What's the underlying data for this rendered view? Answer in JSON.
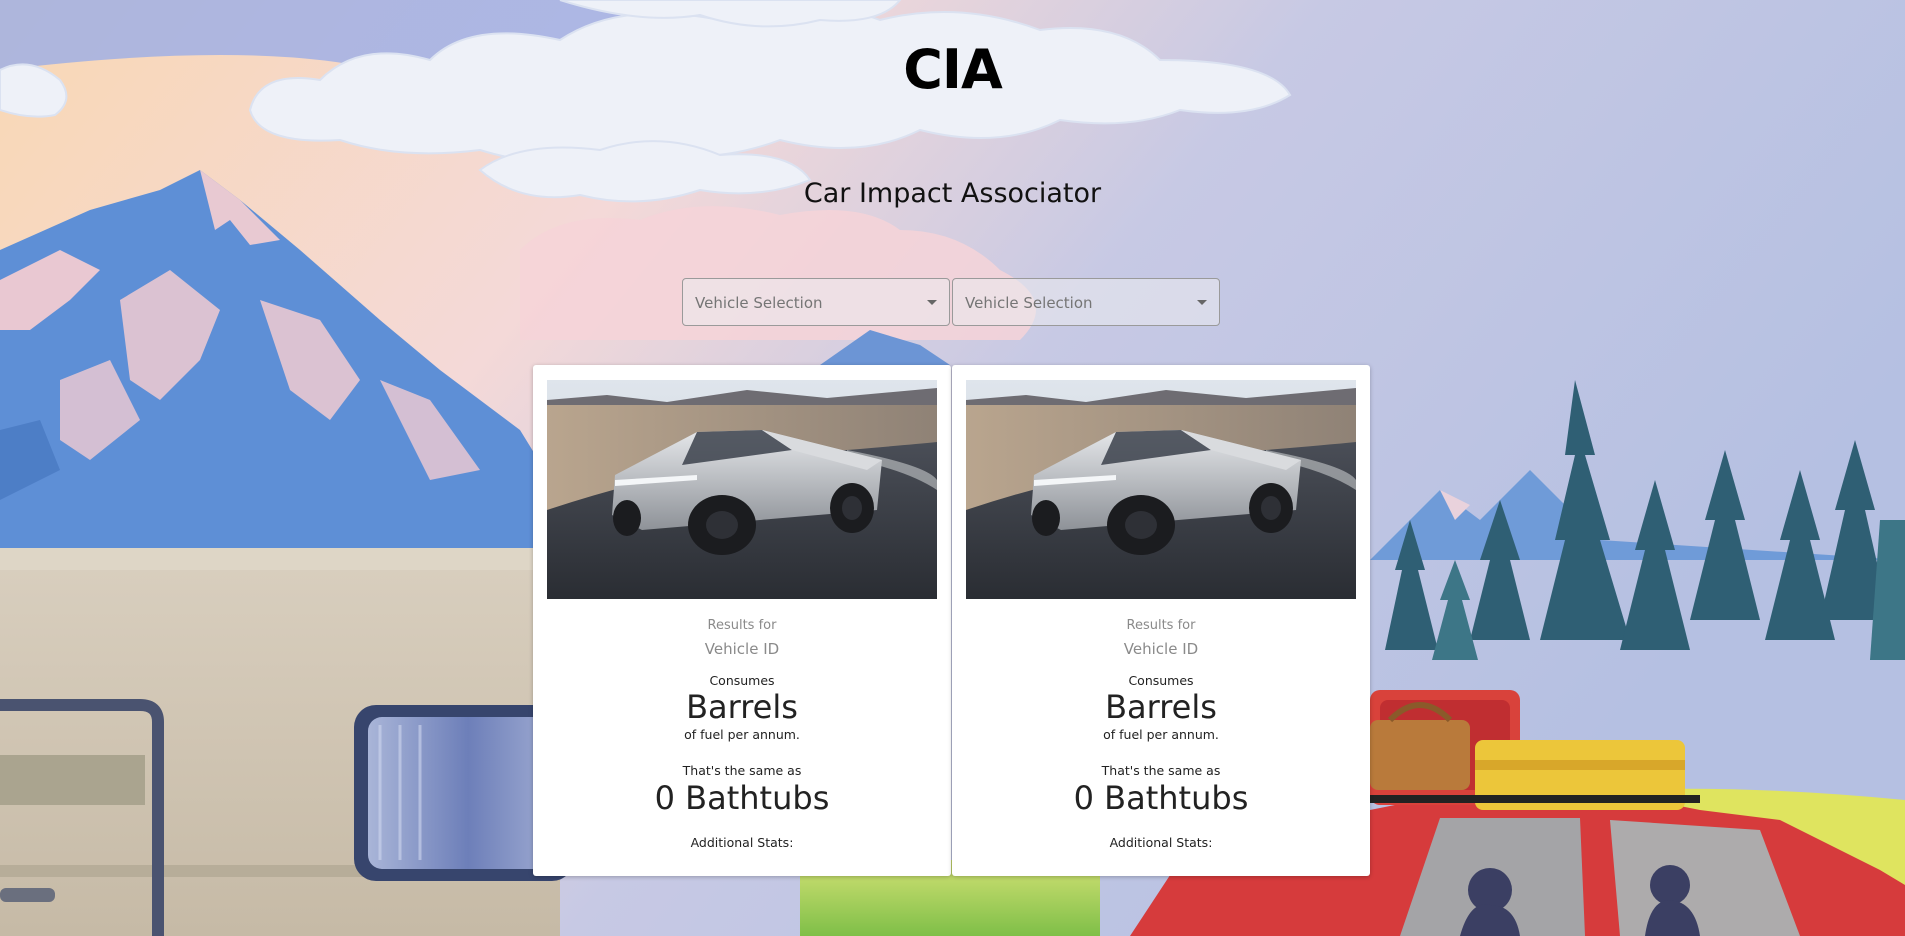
{
  "header": {
    "title": "CIA",
    "subtitle": "Car Impact Associator"
  },
  "selectors": [
    {
      "placeholder": "Vehicle Selection"
    },
    {
      "placeholder": "Vehicle Selection"
    }
  ],
  "cards": [
    {
      "results_for": "Results for",
      "vehicle_id": "Vehicle ID",
      "consumes": "Consumes",
      "barrels": "Barrels",
      "fuel_per_annum": "of fuel per annum.",
      "same_as": "That's the same as",
      "bathtubs": "0 Bathtubs",
      "additional_stats": "Additional Stats:"
    },
    {
      "results_for": "Results for",
      "vehicle_id": "Vehicle ID",
      "consumes": "Consumes",
      "barrels": "Barrels",
      "fuel_per_annum": "of fuel per annum.",
      "same_as": "That's the same as",
      "bathtubs": "0 Bathtubs",
      "additional_stats": "Additional Stats:"
    }
  ],
  "icons": {
    "select_caret": "caret-down-icon"
  }
}
